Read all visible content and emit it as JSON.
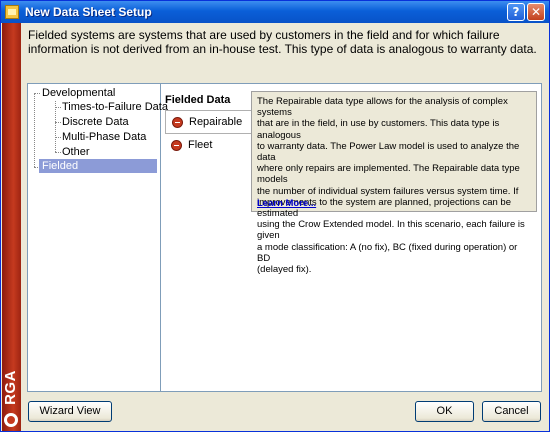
{
  "window": {
    "title": "New Data Sheet Setup",
    "help_label": "?",
    "close_label": "✕"
  },
  "sidebar": {
    "brand": "RGA"
  },
  "description": "Fielded systems are systems that are used by customers in the field and for which failure information is not derived from an in-house test. This type of data is analogous to warranty data.",
  "tree": {
    "root": "Developmental",
    "children": [
      "Times-to-Failure Data",
      "Discrete Data",
      "Multi-Phase Data",
      "Other"
    ],
    "selected": "Fielded"
  },
  "fielded": {
    "header": "Fielded Data",
    "types": [
      {
        "label": "Repairable",
        "icon": "repairable-icon"
      },
      {
        "label": "Fleet",
        "icon": "fleet-icon"
      }
    ],
    "info_lines": [
      "The Repairable data type allows for the analysis of complex systems",
      "that are in the field, in use by customers. This data type is analogous",
      "to warranty data. The Power Law model is used to analyze the data",
      "where only repairs are implemented. The Repairable data type models",
      "the number of individual system failures versus system time. If",
      "improvements to the system are planned, projections can be estimated",
      "using the Crow Extended model. In this scenario, each failure is given",
      "a mode classification: A (no fix), BC (fixed during operation) or BD",
      "(delayed fix)."
    ],
    "learn_more": "Learn More..."
  },
  "buttons": {
    "wizard_view": "Wizard View",
    "ok": "OK",
    "cancel": "Cancel"
  },
  "colors": {
    "title_bar": "#0a5fd8",
    "sidebar": "#c53a1f",
    "selection": "#8c9bd7",
    "link": "#0000cc"
  }
}
